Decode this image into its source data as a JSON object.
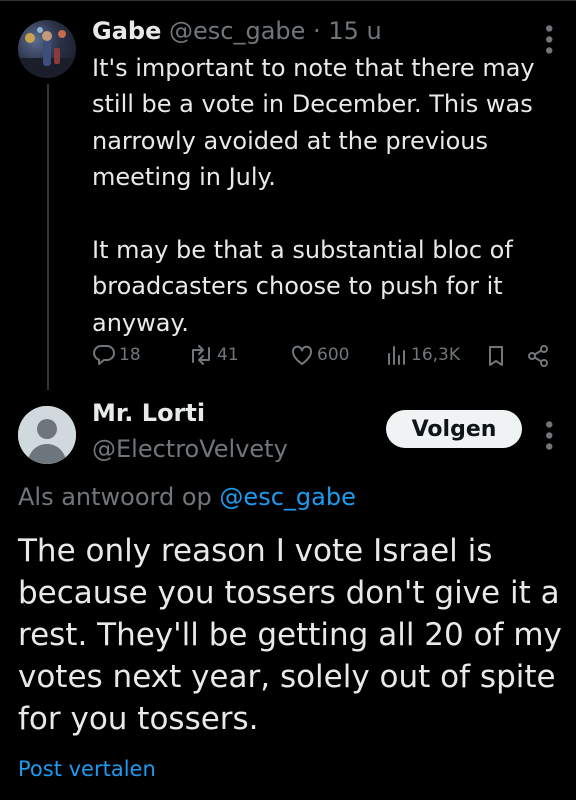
{
  "parent_tweet": {
    "author_name": "Gabe",
    "handle": "@esc_gabe",
    "separator": "·",
    "time": "15 u",
    "text": "It's important to note that there may still be a vote in December. This was narrowly avoided at the previous meeting in July.\n\nIt may be that a substantial bloc of broadcasters choose to push for it anyway.",
    "metrics": {
      "replies": "18",
      "reposts": "41",
      "likes": "600",
      "views": "16,3K"
    }
  },
  "reply_tweet": {
    "author_name": "Mr. Lorti",
    "handle": "@ElectroVelvety",
    "follow_label": "Volgen",
    "reply_prefix": "Als antwoord op",
    "reply_to": "@esc_gabe",
    "text": "The only reason I vote Israel is because you tossers don't give it a rest. They'll be getting all 20 of my votes next year, solely out of spite for you tossers.",
    "translate_label": "Post vertalen"
  },
  "colors": {
    "background": "#000000",
    "text": "#e7e9ea",
    "muted": "#71767b",
    "link": "#1d9bf0"
  }
}
